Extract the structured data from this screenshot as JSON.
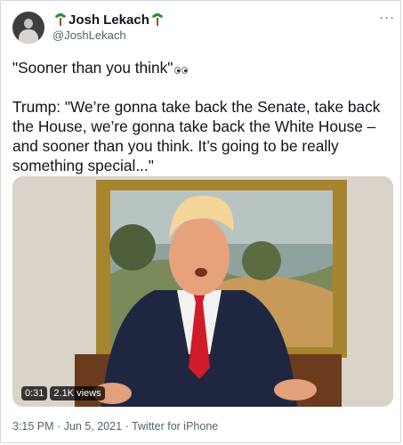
{
  "author": {
    "display_name": "Josh Lekach",
    "handle": "@JoshLekach",
    "avatar_icon": "profile-photo",
    "name_emojis": [
      "palm-tree-icon",
      "palm-tree-icon"
    ]
  },
  "more_icon": "more-options-icon",
  "more_label": "···",
  "tweet": {
    "line1": "\"Sooner than you think\"",
    "line1_emoji": "eyes-emoji",
    "line2": "Trump: \"We’re gonna take back the Senate, take back the House, we’re gonna take back the White House – and sooner than you think. It’s going to be really something special...\""
  },
  "media": {
    "type": "video",
    "duration": "0:31",
    "views": "2.1K views"
  },
  "meta": {
    "time": "3:15 PM",
    "date": "Jun 5, 2021",
    "source": "Twitter for iPhone",
    "separator": "·"
  },
  "colors": {
    "text": "#0f1419",
    "secondary": "#536471",
    "border": "#cfd9de"
  }
}
